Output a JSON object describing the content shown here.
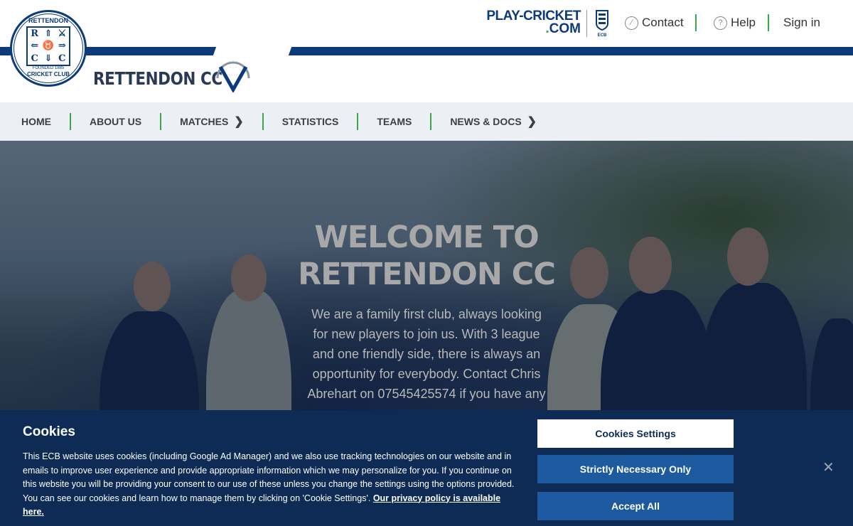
{
  "header": {
    "logo": {
      "top_text": "RETTENDON",
      "founded_text": "FOUNDED 1885",
      "bottom_text": "CRICKET CLUB",
      "shield_letters": [
        "R",
        "C",
        "C",
        "C"
      ]
    },
    "site_name": "RETTENDON CC",
    "playcricket": {
      "line1": "PLAY-CRICKET",
      "line2_dot": ".",
      "line2": "COM"
    },
    "ecb_label": "ECB",
    "links": {
      "contact": "Contact",
      "help": "Help",
      "signin": "Sign in"
    }
  },
  "nav": {
    "items": [
      {
        "label": "HOME",
        "chevron": false
      },
      {
        "label": "ABOUT US",
        "chevron": false
      },
      {
        "label": "MATCHES",
        "chevron": true
      },
      {
        "label": "STATISTICS",
        "chevron": false
      },
      {
        "label": "TEAMS",
        "chevron": false
      },
      {
        "label": "NEWS & DOCS",
        "chevron": true
      }
    ],
    "chevron_glyph": "❯"
  },
  "hero": {
    "title_line1": "WELCOME TO",
    "title_line2": "RETTENDON CC",
    "text": "We are a family first club, always looking for new players to join us. With 3 league and one friendly side, there is always an opportunity for everybody. Contact Chris Abrehart on 07545425574 if you have any"
  },
  "cookie": {
    "title": "Cookies",
    "text": "This ECB website uses cookies (including Google Ad Manager) and we also use tracking technologies on our website and in emails to improve user experience and provide appropriate information which we may personalize for you. If you continue on this website you will be providing your consent to our use of these unless you change the settings using the options provided. You can see our cookies and learn how to manage them by clicking on 'Cookie Settings'.",
    "link": "Our privacy policy is available here.",
    "buttons": {
      "settings": "Cookies Settings",
      "strict": "Strictly Necessary Only",
      "accept": "Accept All"
    },
    "close": "✕"
  },
  "colors": {
    "brand_blue": "#0c3a7a",
    "accent_green": "#3aa64a",
    "banner_bg": "#0d2b55",
    "button_blue": "#1e5aa0"
  }
}
